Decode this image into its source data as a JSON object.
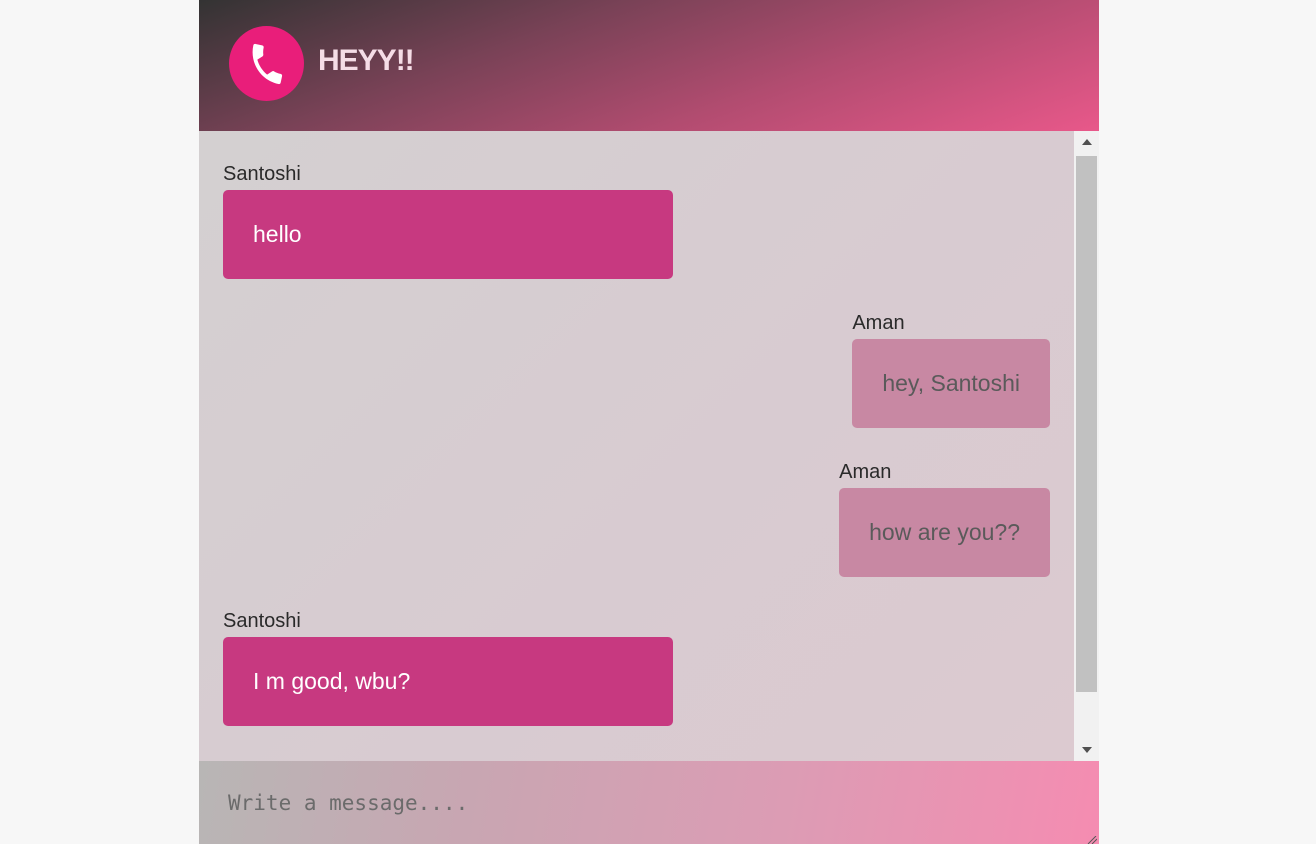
{
  "header": {
    "title": "HEYY!!",
    "icon": "phone-icon",
    "icon_bg": "#e91e7a"
  },
  "messages": [
    {
      "sender": "Santoshi",
      "text": "hello",
      "direction": "incoming"
    },
    {
      "sender": "Aman",
      "text": "hey, Santoshi",
      "direction": "outgoing"
    },
    {
      "sender": "Aman",
      "text": "how are you??",
      "direction": "outgoing"
    },
    {
      "sender": "Santoshi",
      "text": "I m good, wbu?",
      "direction": "incoming"
    }
  ],
  "composer": {
    "placeholder": "Write a message....",
    "value": ""
  },
  "colors": {
    "incoming_bubble": "#c73980",
    "outgoing_bubble": "#c888a3"
  }
}
